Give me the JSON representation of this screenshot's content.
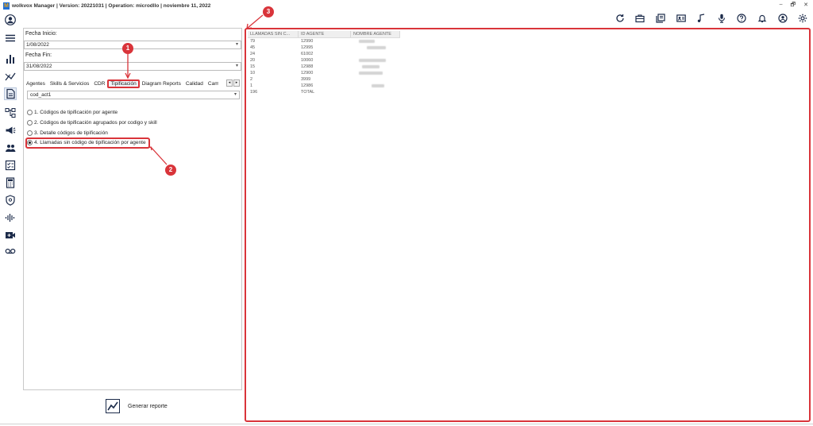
{
  "window": {
    "title": "wolkvox Manager  | Version: 20221031 |  Operation: microdllo | noviembre 11, 2022",
    "controls": [
      "–",
      "🗗",
      "✕"
    ]
  },
  "leftnav": {
    "items": [
      "user-icon",
      "menu-icon",
      "bar-chart-icon",
      "trend-icon",
      "report-icon",
      "flow-icon",
      "campaign-icon",
      "agents-icon",
      "checklist-icon",
      "calculator-icon",
      "shield-icon",
      "audio-icon",
      "video-icon",
      "voicemail-icon"
    ],
    "active": "report-icon"
  },
  "toolbar": {
    "icons": [
      "refresh-icon",
      "briefcase-icon",
      "book-icon",
      "contact-card-icon",
      "music-icon",
      "mic-icon",
      "help-icon",
      "bell-icon",
      "account-icon",
      "settings-icon"
    ]
  },
  "form": {
    "fecha_inicio_label": "Fecha Inicio:",
    "fecha_inicio_value": "1/08/2022",
    "fecha_fin_label": "Fecha Fin:",
    "fecha_fin_value": "31/08/2022",
    "tabs": [
      "Agentes",
      "Skills & Servicios",
      "CDR",
      "Tipificación",
      "Diagram Reports",
      "Calidad",
      "Cam"
    ],
    "active_tab": "Tipificación",
    "select_value": "cod_act1",
    "options": [
      "1. Códigos de tipificación por agente",
      "2. Códigos de tipificación agrupados por codigo y skill",
      "3. Detalle códigos de tipificación",
      "4. Llamadas sin código de tipificación por agente"
    ],
    "selected_option": 3,
    "generate_label": "Generar reporte"
  },
  "results": {
    "columns": [
      "LLAMADAS SIN C...",
      "ID AGENTE",
      "NOMBRE AGENTE"
    ],
    "rows": [
      [
        "79",
        "12990"
      ],
      [
        "45",
        "12995"
      ],
      [
        "24",
        "61002"
      ],
      [
        "20",
        "10060"
      ],
      [
        "15",
        "12988"
      ],
      [
        "10",
        "12900"
      ],
      [
        "2",
        "3999"
      ],
      [
        "1",
        "12986"
      ],
      [
        "196",
        "TOTAL"
      ]
    ]
  },
  "annotations": [
    "1",
    "2",
    "3"
  ],
  "colors": {
    "accent": "#d9343a",
    "nav_dark": "#1c2b4a"
  }
}
